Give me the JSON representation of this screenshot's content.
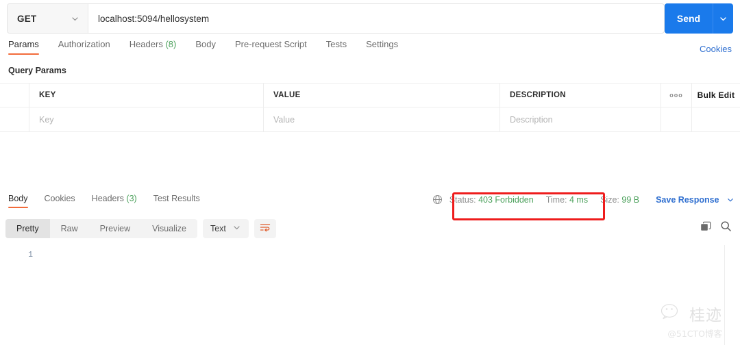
{
  "request": {
    "method": "GET",
    "method_caret_icon": "chevron-down-icon",
    "url": "localhost:5094/hellosystem",
    "url_placeholder": "Enter request URL",
    "send_label": "Send",
    "send_caret_icon": "chevron-down-icon"
  },
  "request_tabs": [
    {
      "label": "Params",
      "count": "",
      "active": true
    },
    {
      "label": "Authorization",
      "count": "",
      "active": false
    },
    {
      "label": "Headers",
      "count": "(8)",
      "active": false
    },
    {
      "label": "Body",
      "count": "",
      "active": false
    },
    {
      "label": "Pre-request Script",
      "count": "",
      "active": false
    },
    {
      "label": "Tests",
      "count": "",
      "active": false
    },
    {
      "label": "Settings",
      "count": "",
      "active": false
    }
  ],
  "cookies_link": "Cookies",
  "params": {
    "section_title": "Query Params",
    "columns": [
      "KEY",
      "VALUE",
      "DESCRIPTION"
    ],
    "options_icon": "ooo",
    "bulk_edit_label": "Bulk Edit",
    "rows": [
      {
        "key": "Key",
        "value": "Value",
        "description": "Description"
      }
    ]
  },
  "response_tabs": [
    {
      "label": "Body",
      "count": "",
      "active": true
    },
    {
      "label": "Cookies",
      "count": "",
      "active": false
    },
    {
      "label": "Headers",
      "count": "(3)",
      "active": false
    },
    {
      "label": "Test Results",
      "count": "",
      "active": false
    }
  ],
  "response_status": {
    "globe_icon": "globe-icon",
    "status_label": "Status:",
    "status_value": "403 Forbidden",
    "time_label": "Time:",
    "time_value": "4 ms",
    "size_label": "Size:",
    "size_value": "99 B",
    "save_response_label": "Save Response",
    "save_caret_icon": "chevron-down-icon",
    "status_color": "#4ca15c",
    "highlight_color": "#ee1c1c"
  },
  "body_toolbar": {
    "views": [
      {
        "label": "Pretty",
        "active": true
      },
      {
        "label": "Raw",
        "active": false
      },
      {
        "label": "Preview",
        "active": false
      },
      {
        "label": "Visualize",
        "active": false
      }
    ],
    "format": "Text",
    "format_caret_icon": "chevron-down-icon",
    "wrap_icon": "wrap-text-icon",
    "copy_icon": "copy-icon",
    "search_icon": "search-icon"
  },
  "body_viewer": {
    "line_numbers": [
      "1"
    ],
    "content": ""
  },
  "watermark": {
    "icon": "wechat-icon",
    "name": "桂迹",
    "handle": "@51CTO博客"
  },
  "theme": {
    "accent": "#f26b3a",
    "primary": "#1a7aeb",
    "link": "#2f6fd0",
    "success": "#4ca15c"
  }
}
